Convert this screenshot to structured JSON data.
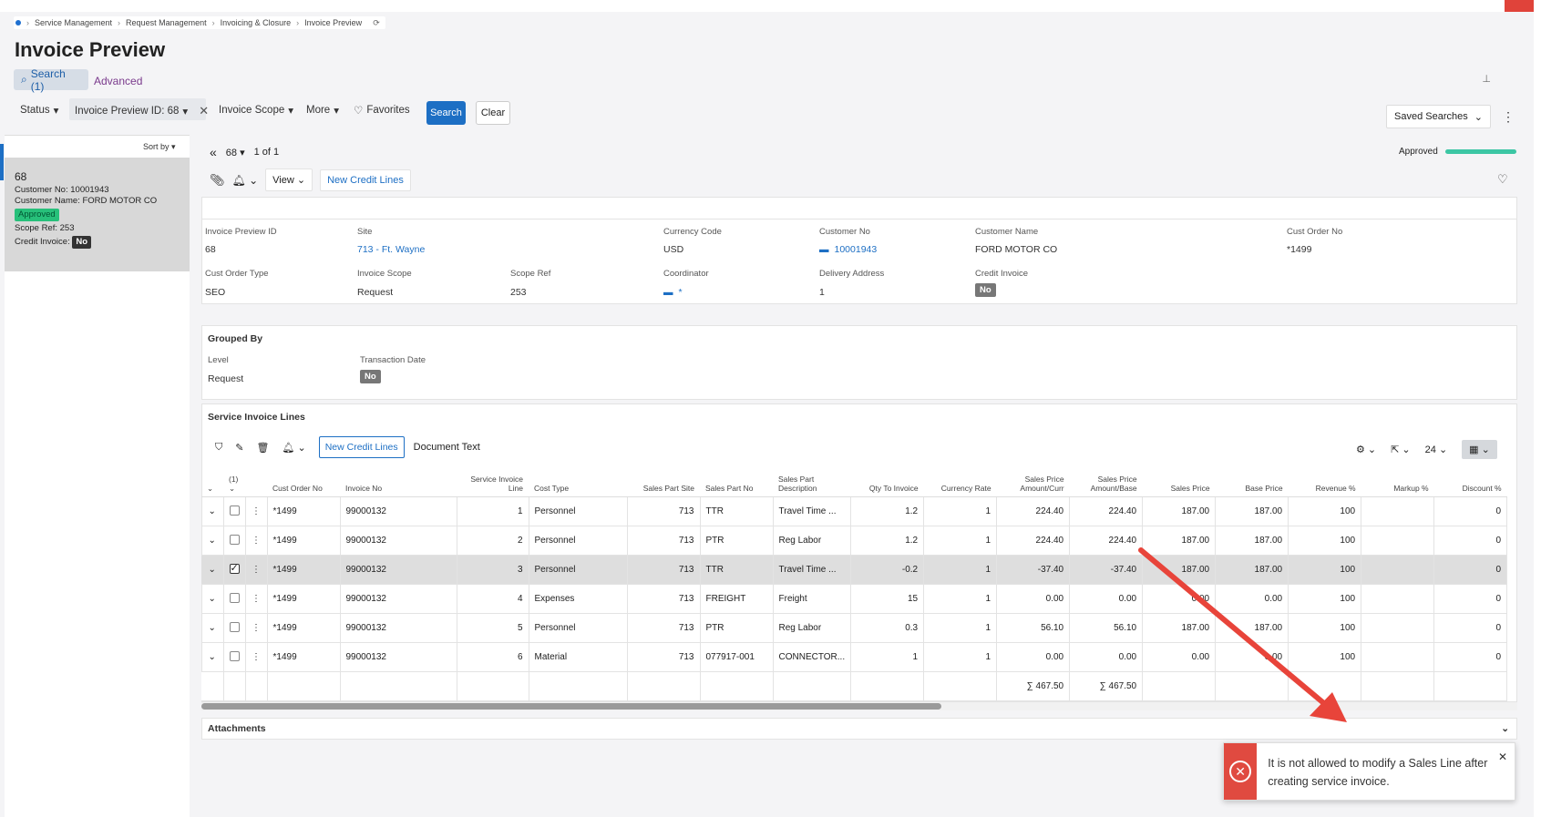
{
  "breadcrumb": [
    "Service Management",
    "Request Management",
    "Invoicing & Closure",
    "Invoice Preview"
  ],
  "page_title": "Invoice Preview",
  "tabs": {
    "search": "Search (1)",
    "advanced": "Advanced"
  },
  "filters": {
    "status": "Status",
    "invoice_preview_id": "Invoice Preview ID: 68",
    "invoice_scope": "Invoice Scope",
    "more": "More",
    "favorites": "Favorites",
    "search_btn": "Search",
    "clear_btn": "Clear",
    "saved_searches": "Saved Searches"
  },
  "sort_by": "Sort by",
  "card": {
    "id": "68",
    "customer_no_label": "Customer No:",
    "customer_no": "10001943",
    "customer_name_label": "Customer Name:",
    "customer_name": "FORD MOTOR CO",
    "status": "Approved",
    "scope_ref_label": "Scope Ref:",
    "scope_ref": "253",
    "credit_invoice_label": "Credit Invoice:",
    "credit_invoice": "No"
  },
  "nav": {
    "record": "68",
    "paging": "1 of 1",
    "status": "Approved"
  },
  "toolbar": {
    "view": "View",
    "new_credit_lines": "New Credit Lines"
  },
  "header": {
    "invoice_preview_id_label": "Invoice Preview ID",
    "invoice_preview_id": "68",
    "site_label": "Site",
    "site": "713 - Ft. Wayne",
    "currency_code_label": "Currency Code",
    "currency_code": "USD",
    "customer_no_label": "Customer No",
    "customer_no": "10001943",
    "customer_name_label": "Customer Name",
    "customer_name": "FORD MOTOR CO",
    "cust_order_no_label": "Cust Order No",
    "cust_order_no": "*1499",
    "cust_order_type_label": "Cust Order Type",
    "cust_order_type": "SEO",
    "invoice_scope_label": "Invoice Scope",
    "invoice_scope": "Request",
    "scope_ref_label": "Scope Ref",
    "scope_ref": "253",
    "coordinator_label": "Coordinator",
    "coordinator": "*",
    "delivery_address_label": "Delivery Address",
    "delivery_address": "1",
    "credit_invoice_label": "Credit Invoice",
    "credit_invoice": "No"
  },
  "grouped_by": {
    "title": "Grouped By",
    "level_label": "Level",
    "level": "Request",
    "transaction_date_label": "Transaction Date",
    "transaction_date": "No"
  },
  "lines": {
    "title": "Service Invoice Lines",
    "new_credit_lines": "New Credit Lines",
    "document_text": "Document Text",
    "page_size": "24",
    "selected_count": "(1)",
    "columns": [
      "Cust Order No",
      "Invoice No",
      "Service Invoice Line",
      "Cost Type",
      "Sales Part Site",
      "Sales Part No",
      "Sales Part Description",
      "Qty To Invoice",
      "Currency Rate",
      "Sales Price Amount/Curr",
      "Sales Price Amount/Base",
      "Sales Price",
      "Base Price",
      "Revenue %",
      "Markup %",
      "Discount %"
    ],
    "rows": [
      [
        "*1499",
        "99000132",
        "1",
        "Personnel",
        "713",
        "TTR",
        "Travel Time ...",
        "1.2",
        "1",
        "224.40",
        "224.40",
        "187.00",
        "187.00",
        "100",
        "",
        "0"
      ],
      [
        "*1499",
        "99000132",
        "2",
        "Personnel",
        "713",
        "PTR",
        "Reg Labor",
        "1.2",
        "1",
        "224.40",
        "224.40",
        "187.00",
        "187.00",
        "100",
        "",
        "0"
      ],
      [
        "*1499",
        "99000132",
        "3",
        "Personnel",
        "713",
        "TTR",
        "Travel Time ...",
        "-0.2",
        "1",
        "-37.40",
        "-37.40",
        "187.00",
        "187.00",
        "100",
        "",
        "0"
      ],
      [
        "*1499",
        "99000132",
        "4",
        "Expenses",
        "713",
        "FREIGHT",
        "Freight",
        "15",
        "1",
        "0.00",
        "0.00",
        "0.00",
        "0.00",
        "100",
        "",
        "0"
      ],
      [
        "*1499",
        "99000132",
        "5",
        "Personnel",
        "713",
        "PTR",
        "Reg Labor",
        "0.3",
        "1",
        "56.10",
        "56.10",
        "187.00",
        "187.00",
        "100",
        "",
        "0"
      ],
      [
        "*1499",
        "99000132",
        "6",
        "Material",
        "713",
        "077917-001",
        "CONNECTOR...",
        "1",
        "1",
        "0.00",
        "0.00",
        "0.00",
        "0.00",
        "100",
        "",
        "0"
      ]
    ],
    "selected_row": 2,
    "totals": {
      "amount_curr": "∑ 467.50",
      "amount_base": "∑ 467.50"
    }
  },
  "attachments": "Attachments",
  "toast": {
    "message": "It is not allowed to modify a Sales Line after creating service invoice."
  }
}
